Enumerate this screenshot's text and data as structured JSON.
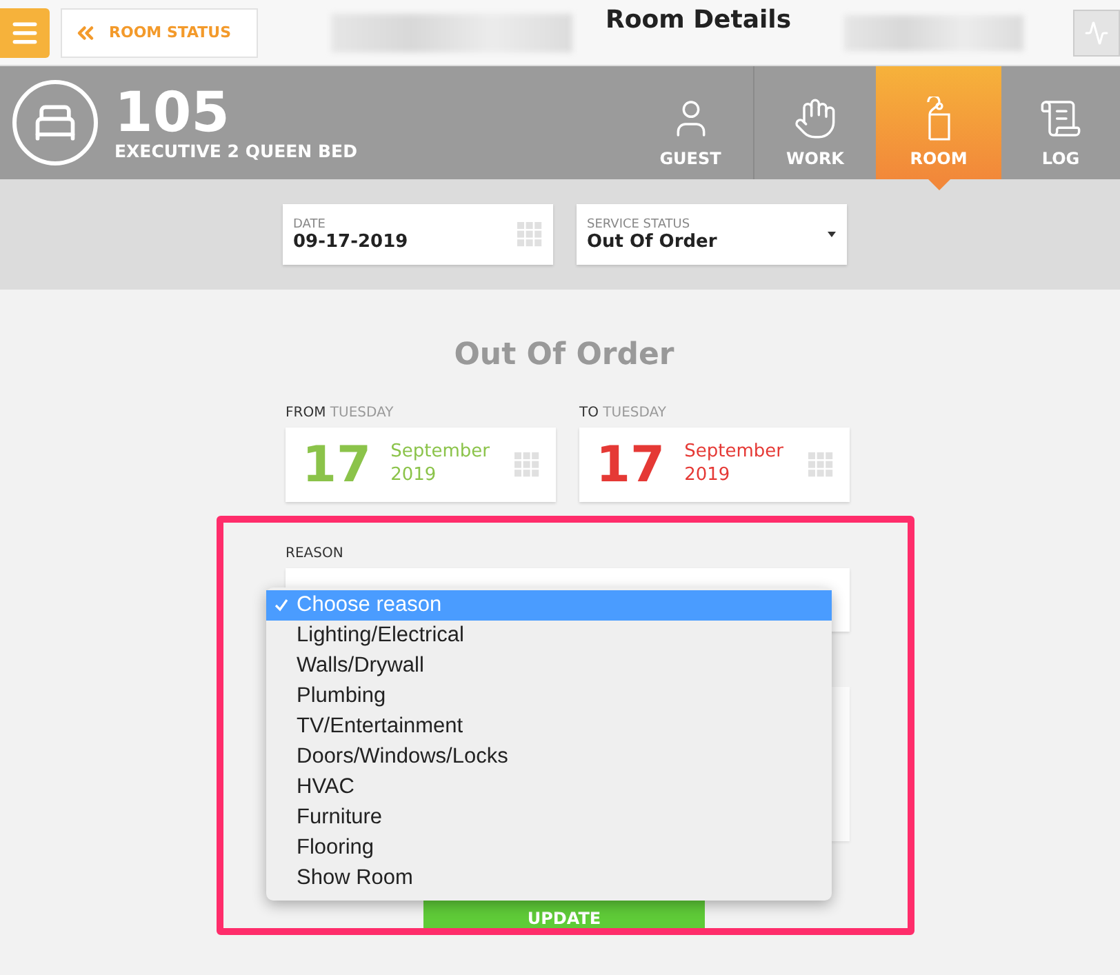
{
  "top_bar": {
    "back_button": "ROOM STATUS",
    "title": "Room Details"
  },
  "room": {
    "number": "105",
    "type": "EXECUTIVE 2 QUEEN BED"
  },
  "tabs": [
    {
      "label": "GUEST",
      "kind": "guest",
      "selected": false
    },
    {
      "label": "WORK",
      "kind": "work",
      "selected": false
    },
    {
      "label": "ROOM",
      "kind": "room",
      "selected": true
    },
    {
      "label": "LOG",
      "kind": "log",
      "selected": false
    }
  ],
  "date_field": {
    "label": "DATE",
    "value": "09-17-2019"
  },
  "service_status": {
    "label": "SERVICE STATUS",
    "value": "Out Of Order"
  },
  "section_title": "Out Of Order",
  "range": [
    {
      "label": "FROM",
      "weekday": "TUESDAY",
      "day": "17",
      "month": "September",
      "year": "2019",
      "color": "#8bc34a"
    },
    {
      "label": "TO",
      "weekday": "TUESDAY",
      "day": "17",
      "month": "September",
      "year": "2019",
      "color": "#e53935"
    }
  ],
  "reason": {
    "label": "REASON",
    "options": [
      {
        "label": "Choose reason",
        "selected": true
      },
      {
        "label": "Lighting/Electrical",
        "selected": false
      },
      {
        "label": "Walls/Drywall",
        "selected": false
      },
      {
        "label": "Plumbing",
        "selected": false
      },
      {
        "label": "TV/Entertainment",
        "selected": false
      },
      {
        "label": "Doors/Windows/Locks",
        "selected": false
      },
      {
        "label": "HVAC",
        "selected": false
      },
      {
        "label": "Furniture",
        "selected": false
      },
      {
        "label": "Flooring",
        "selected": false
      },
      {
        "label": "Show Room",
        "selected": false
      }
    ]
  },
  "update_button": "UPDATE"
}
